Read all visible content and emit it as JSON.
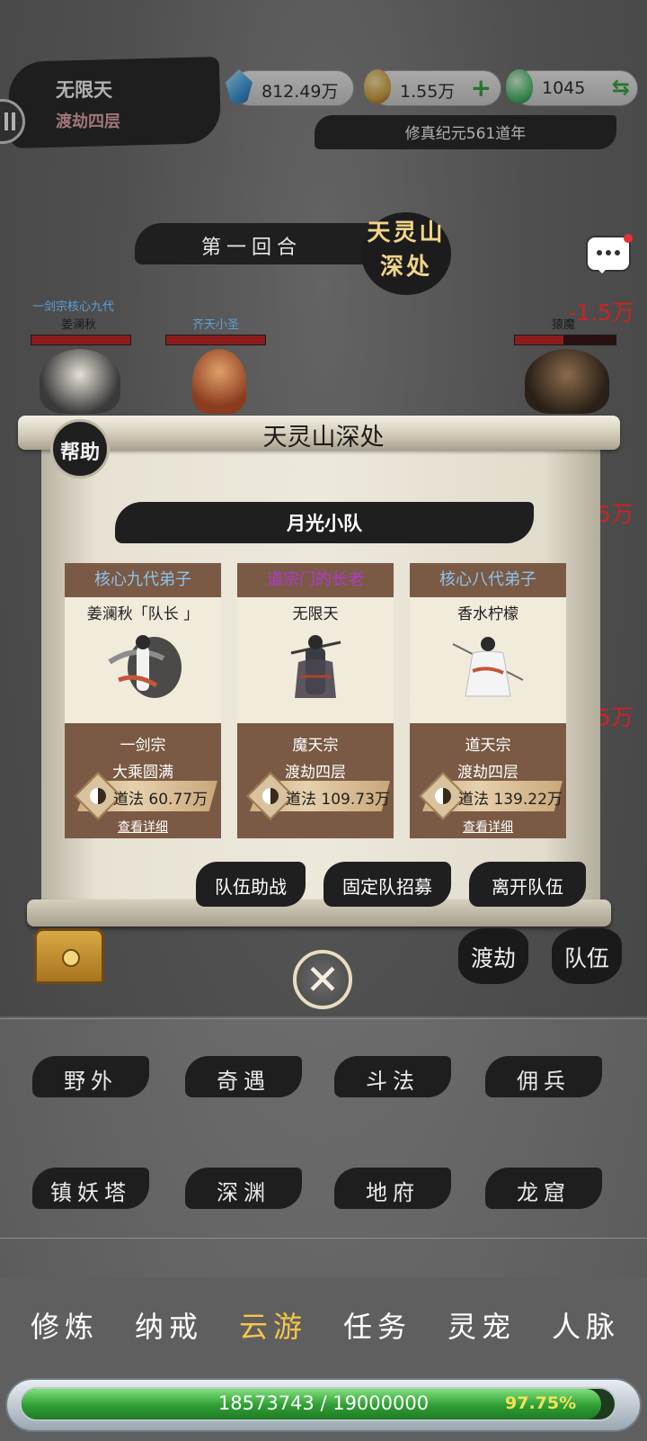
{
  "header": {
    "player_name": "无限天",
    "player_realm": "渡劫四层",
    "resources": [
      {
        "icon": "spirit-stone-icon",
        "value": "812.49万"
      },
      {
        "icon": "gold-gourd-icon",
        "value": "1.55万",
        "action": "+"
      },
      {
        "icon": "jade-gourd-icon",
        "value": "1045",
        "action": "⇆"
      }
    ],
    "era": "修真纪元561道年"
  },
  "battle": {
    "round": "第一回合",
    "location": "天灵山深处",
    "allies": [
      {
        "title": "一剑宗核心九代",
        "name": "姜澜秋",
        "hp": 1.0
      },
      {
        "title": "齐天小圣",
        "name": "",
        "hp": 1.0
      }
    ],
    "enemy": {
      "name": "猿魔",
      "hp": 0.48,
      "damage": "-1.5万"
    },
    "side_damage": [
      "5万",
      "5万"
    ]
  },
  "dialog": {
    "title": "天灵山深处",
    "help_label": "帮助",
    "team_name": "月光小队",
    "members": [
      {
        "rank": "核心九代弟子",
        "rank_color": "#8ec2f0",
        "name": "姜澜秋「队长 」",
        "sect": "一剑宗",
        "realm": "大乘圆满",
        "dao": "道法  60.77万",
        "detail": "查看详细"
      },
      {
        "rank": "道宗门的长老",
        "rank_color": "#b03ad2",
        "name": "无限天",
        "sect": "魔天宗",
        "realm": "渡劫四层",
        "dao": "道法  109.73万",
        "detail": ""
      },
      {
        "rank": "核心八代弟子",
        "rank_color": "#8ec2f0",
        "name": "香水柠檬",
        "sect": "道天宗",
        "realm": "渡劫四层",
        "dao": "道法  139.22万",
        "detail": "查看详细"
      }
    ],
    "actions": [
      "队伍助战",
      "固定队招募",
      "离开队伍"
    ]
  },
  "side_buttons": [
    "渡劫",
    "队伍"
  ],
  "close_label": "✕",
  "areas": [
    "野外",
    "奇遇",
    "斗法",
    "佣兵",
    "镇妖塔",
    "深渊",
    "地府",
    "龙窟"
  ],
  "tabs": [
    {
      "label": "修炼",
      "active": false
    },
    {
      "label": "纳戒",
      "active": false
    },
    {
      "label": "云游",
      "active": true
    },
    {
      "label": "任务",
      "active": false
    },
    {
      "label": "灵宠",
      "active": false
    },
    {
      "label": "人脉",
      "active": false
    }
  ],
  "exp": {
    "text": "18573743 / 19000000",
    "percent_label": "97.75%",
    "fraction": 0.9775
  }
}
